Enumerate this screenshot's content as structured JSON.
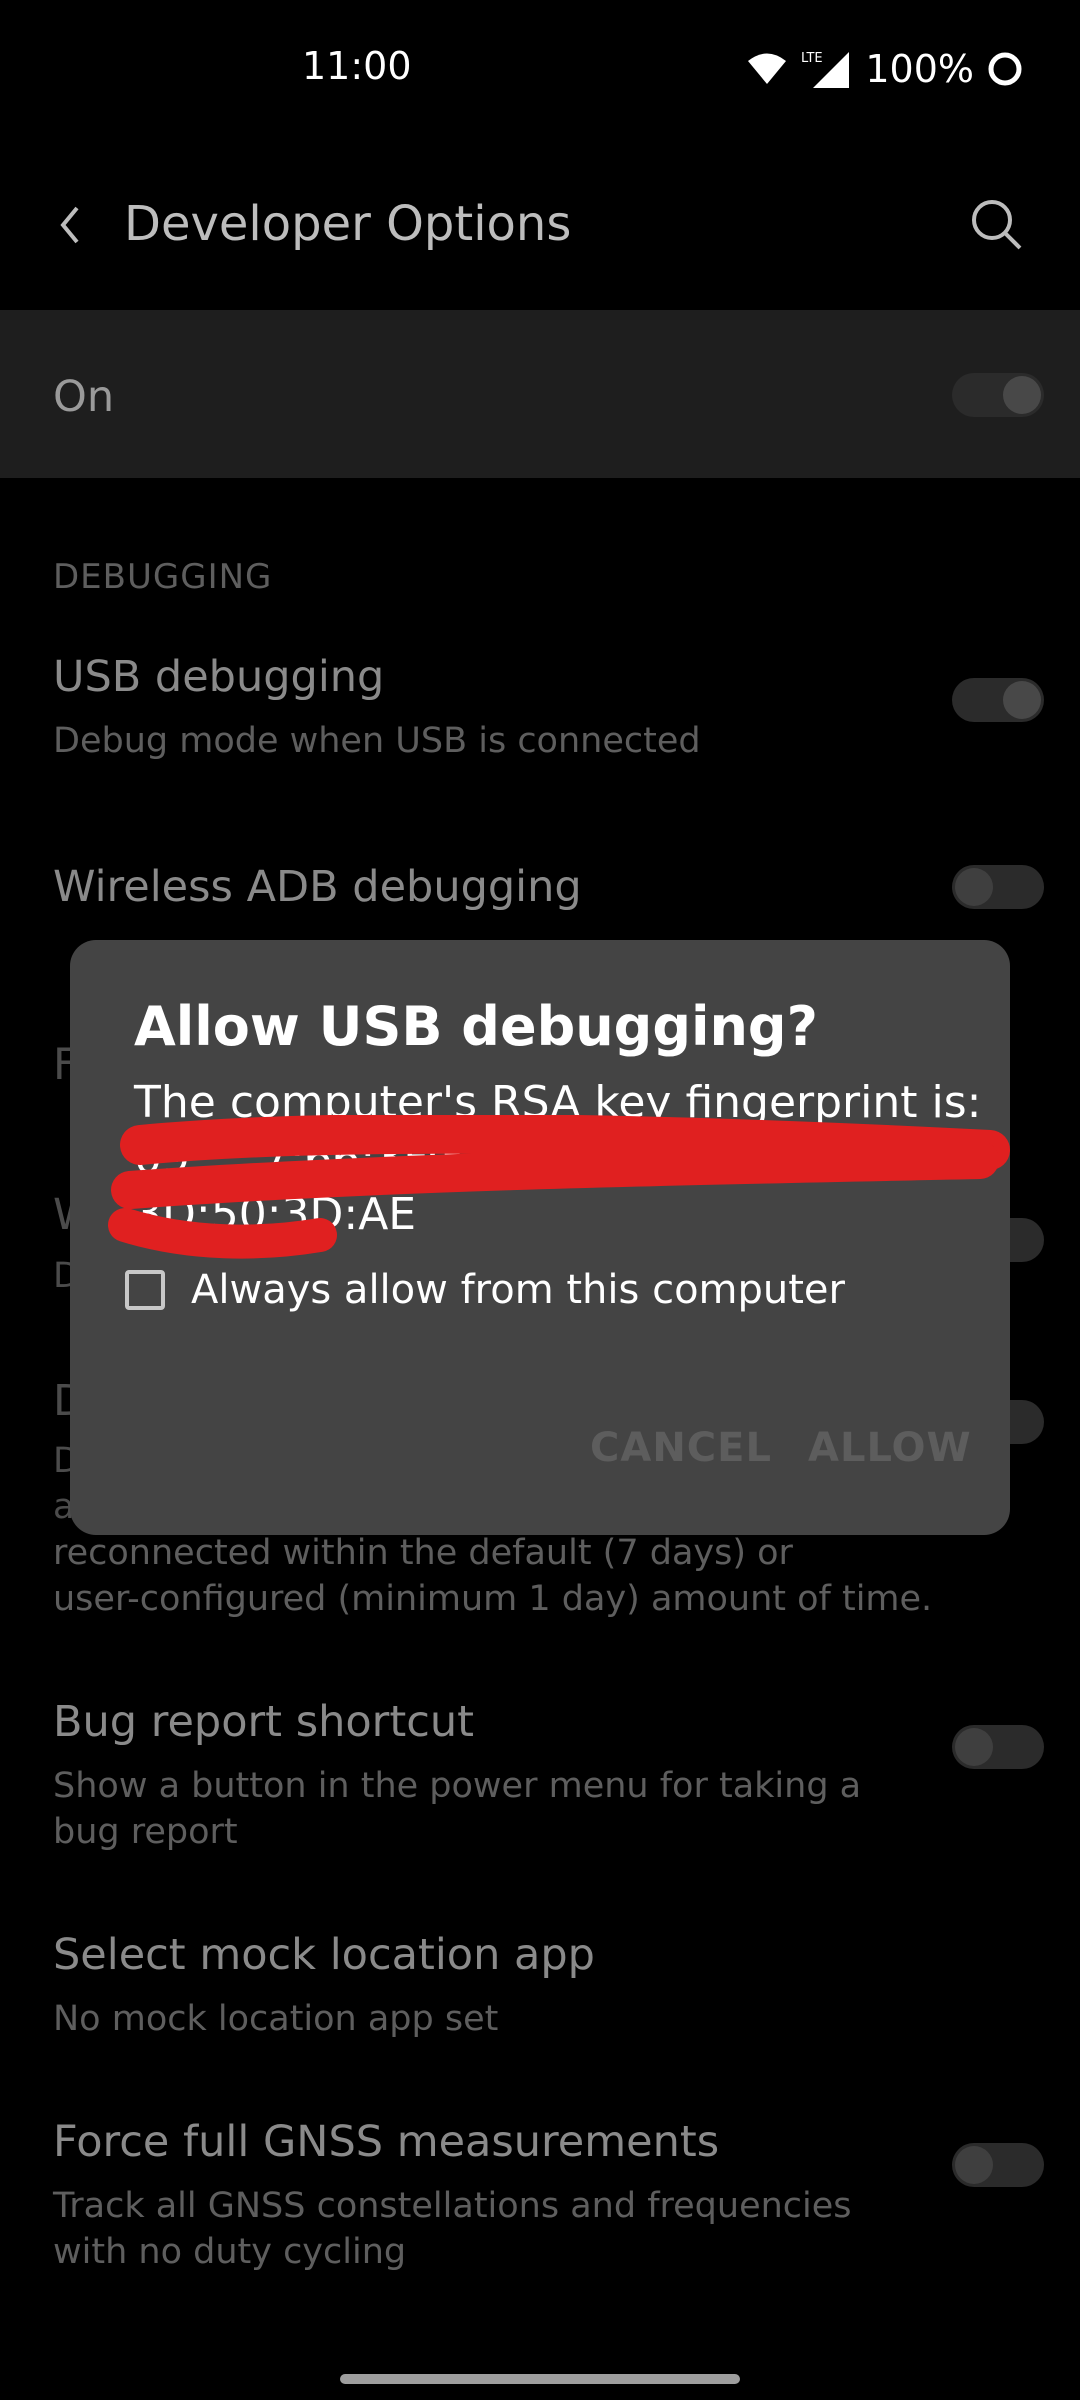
{
  "status_bar": {
    "time": "11:00",
    "network": "LTE",
    "battery": "100%"
  },
  "app_bar": {
    "title": "Developer Options"
  },
  "master_switch": {
    "label": "On",
    "on": true
  },
  "sections": {
    "debugging_header": "DEBUGGING"
  },
  "settings": {
    "usb_debugging": {
      "title": "USB debugging",
      "subtitle": "Debug mode when USB is connected",
      "on": true
    },
    "wireless_adb": {
      "title": "Wireless ADB debugging",
      "on": false
    },
    "partial_rows": {
      "row1_initial": "F",
      "row2_initial": "W",
      "row2_sub_initial": "D",
      "row3_initial": "D",
      "row3_sub_initial_a": "D",
      "row3_sub_initial_b": "a"
    },
    "revoke_auth_continued": {
      "line1": "reconnected within the default (7 days) or",
      "line2": "user-configured (minimum 1 day) amount of time."
    },
    "bug_report_shortcut": {
      "title": "Bug report shortcut",
      "subtitle": "Show a button in the power menu for taking a bug report",
      "on": false
    },
    "mock_location": {
      "title": "Select mock location app",
      "subtitle": "No mock location app set"
    },
    "gnss": {
      "title": "Force full GNSS measurements",
      "subtitle": "Track all GNSS constellations and frequencies with no duty cycling",
      "on": false
    }
  },
  "dialog": {
    "title": "Allow USB debugging?",
    "message": "The computer's RSA key fingerprint is:",
    "fingerprint_line1": "09:...:7:66:3F:5B:3B:0A:7C:53:3C...",
    "fingerprint_line2": "3D:50:3D:AE",
    "checkbox_label": "Always allow from this computer",
    "checkbox_checked": false,
    "cancel_label": "CANCEL",
    "allow_label": "ALLOW",
    "redaction_color": "#e02020"
  },
  "colors": {
    "background": "#000000",
    "dialog": "#444444",
    "disabled_button": "#5d5d5d"
  }
}
